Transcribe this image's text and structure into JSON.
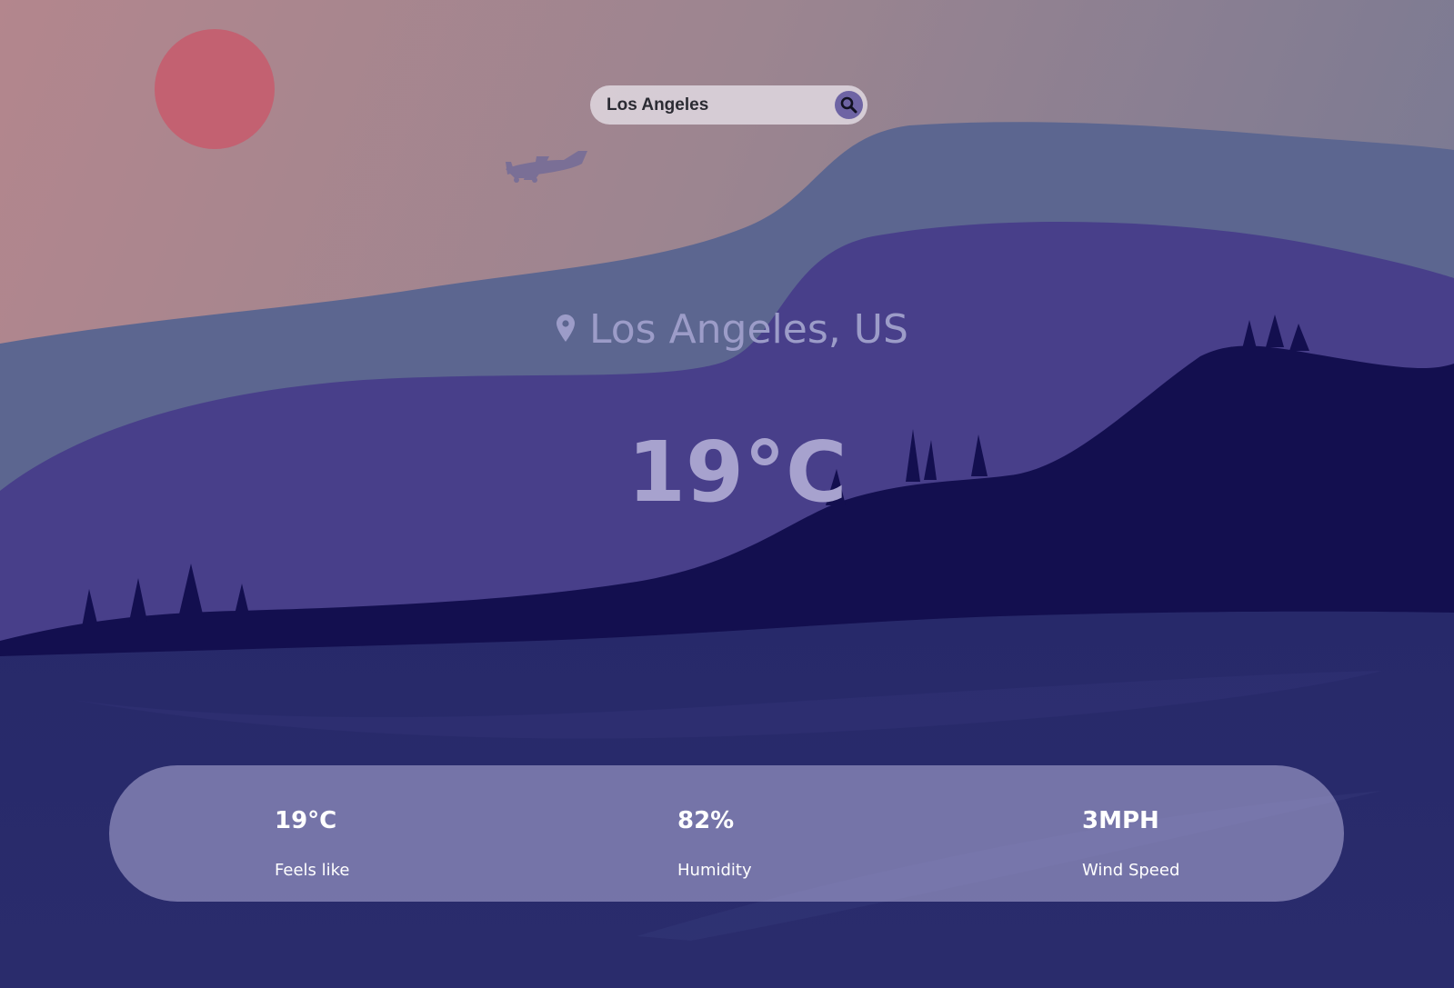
{
  "search": {
    "value": "Los Angeles",
    "icon": "search-icon"
  },
  "location": {
    "icon": "map-pin-icon",
    "name": "Los Angeles, US"
  },
  "current": {
    "temperature": "19°C"
  },
  "stats": [
    {
      "value": "19°C",
      "label": "Feels like"
    },
    {
      "value": "82%",
      "label": "Humidity"
    },
    {
      "value": "3MPH",
      "label": "Wind Speed"
    }
  ],
  "colors": {
    "sky_top_left": "#b3868d",
    "sky_top_right": "#7e7b96",
    "sun": "#c85a6a",
    "far_hills": "#5c6690",
    "mid_hills": "#483f8a",
    "near_hills": "#130f4f",
    "ground": "#2a2b6a",
    "stats_panel": "#a4a2ce",
    "text_muted": "#9c9cc8"
  }
}
